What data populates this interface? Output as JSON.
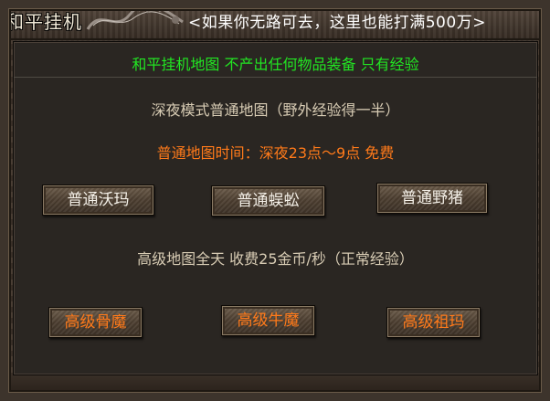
{
  "window": {
    "title": "和平挂机",
    "slogan": "<如果你无路可去，这里也能打满500万>"
  },
  "panel": {
    "header_green": "和平挂机地图  不产出任何物品装备  只有经验",
    "night_mode_title": "深夜模式普通地图（野外经验得一半）",
    "night_time_notice": "普通地图时间：深夜23点～9点 免费",
    "normal_buttons": [
      {
        "label": "普通沃玛"
      },
      {
        "label": "普通蜈蚣"
      },
      {
        "label": "普通野猪"
      }
    ],
    "advanced_title": "高级地图全天  收费25金币/秒（正常经验）",
    "advanced_buttons": [
      {
        "label": "高级骨魔"
      },
      {
        "label": "高级牛魔"
      },
      {
        "label": "高级祖玛"
      }
    ]
  },
  "colors": {
    "header_green": "#22e622",
    "notice_orange": "#ff7a1a",
    "body_beige": "#d8ccb4",
    "button_text": "#f4f0e8"
  },
  "icons": {
    "title_ornament": "dragon-ornament-icon"
  }
}
